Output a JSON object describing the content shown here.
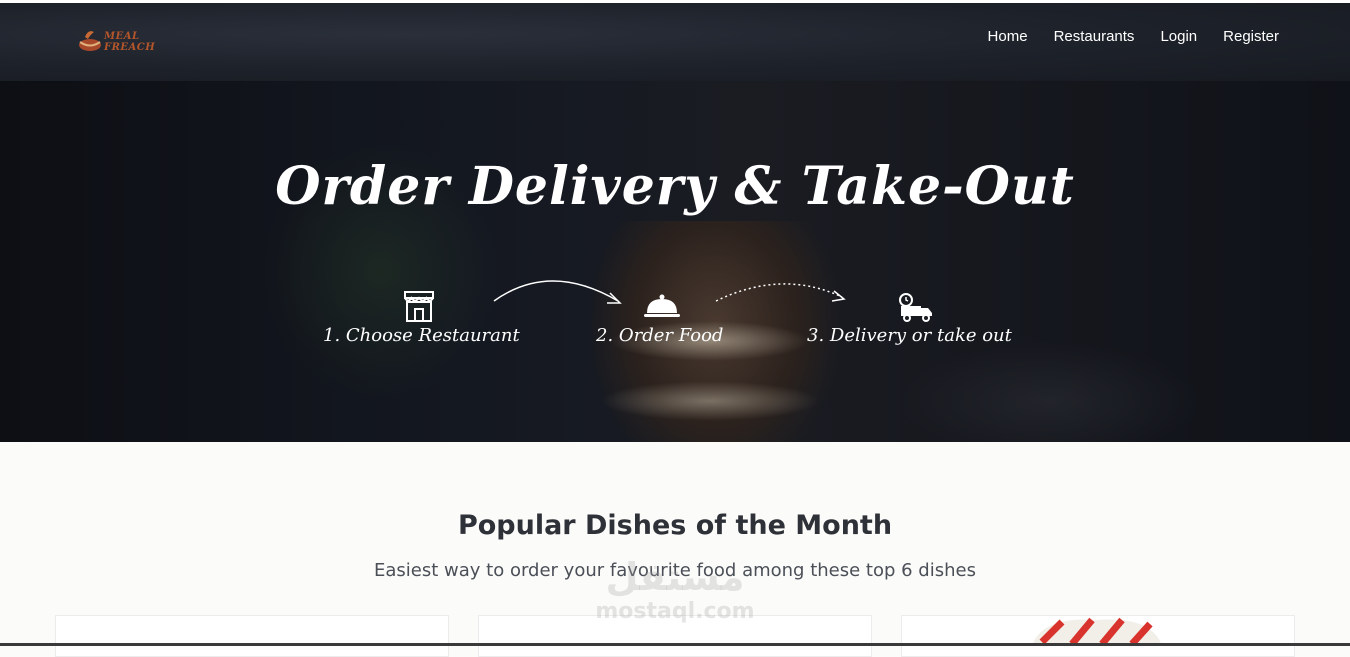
{
  "brand": {
    "logo_text": "MEAL FREACH"
  },
  "nav": {
    "items": [
      {
        "label": "Home"
      },
      {
        "label": "Restaurants"
      },
      {
        "label": "Login"
      },
      {
        "label": "Register"
      }
    ]
  },
  "hero": {
    "title": "Order Delivery & Take-Out",
    "steps": [
      {
        "label": "1. Choose Restaurant",
        "icon": "storefront-icon"
      },
      {
        "label": "2. Order Food",
        "icon": "cloche-icon"
      },
      {
        "label": "3. Delivery or take out",
        "icon": "delivery-truck-icon"
      }
    ]
  },
  "popular": {
    "title": "Popular Dishes of the Month",
    "subtitle": "Easiest way to order your favourite food among these top 6 dishes"
  },
  "watermark": {
    "arabic": "مستقل",
    "latin": "mostaql.com"
  }
}
